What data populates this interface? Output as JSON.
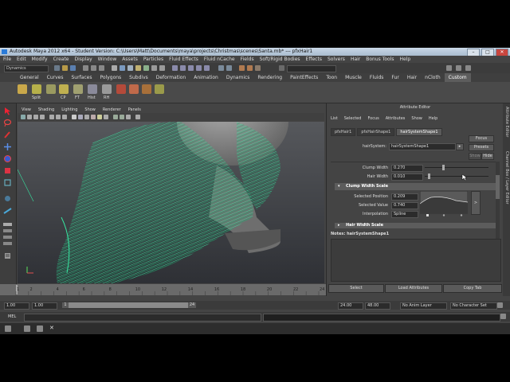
{
  "window": {
    "title": "Autodesk Maya 2012 x64 - Student Version: C:\\Users\\Matt\\Documents\\maya\\projects\\Christmas\\scenes\\Santa.mb* --- pfxHair1",
    "controls": {
      "minimize": "–",
      "maximize": "□",
      "close": "✕"
    }
  },
  "menubar": [
    "File",
    "Edit",
    "Modify",
    "Create",
    "Display",
    "Window",
    "Assets",
    "Particles",
    "Fluid Effects",
    "Fluid nCache",
    "Fields",
    "Soft/Rigid Bodies",
    "Effects",
    "Solvers",
    "Hair",
    "Bonus Tools",
    "Help"
  ],
  "statusline": {
    "menu_set": "Dynamics"
  },
  "shelf_tabs": {
    "items": [
      "General",
      "Curves",
      "Surfaces",
      "Polygons",
      "Subdivs",
      "Deformation",
      "Animation",
      "Dynamics",
      "Rendering",
      "PaintEffects",
      "Toon",
      "Muscle",
      "Fluids",
      "Fur",
      "Hair",
      "nCloth",
      "Custom"
    ],
    "active": "Custom"
  },
  "shelf_labels": [
    "Split",
    "CP",
    "FT",
    "Hist",
    "RH"
  ],
  "viewport": {
    "menu": [
      "View",
      "Shading",
      "Lighting",
      "Show",
      "Renderer",
      "Panels"
    ],
    "hair_color": "#37e5a0"
  },
  "attribute_editor": {
    "title": "Attribute Editor",
    "menu": [
      "List",
      "Selected",
      "Focus",
      "Attributes",
      "Show",
      "Help"
    ],
    "tabs": [
      "pfxHair1",
      "pfxHairShape1",
      "hairSystemShape1"
    ],
    "active_tab": "hairSystemShape1",
    "node_label": "hairSystem:",
    "node_value": "hairSystemShape1",
    "buttons": {
      "focus": "Focus",
      "presets": "Presets",
      "show": "Show",
      "hide": "Hide"
    },
    "attributes": [
      {
        "label": "Clump Width",
        "value": "0.270"
      },
      {
        "label": "Hair Width",
        "value": "0.010"
      }
    ],
    "section_clump": "Clump Width Scale",
    "selected_position_label": "Selected Position",
    "selected_position": "0.209",
    "selected_value_label": "Selected Value",
    "selected_value": "0.740",
    "interpolation_label": "Interpolation",
    "interpolation": "Spline",
    "section_next": "Hair Width Scale",
    "notes": "Notes:  hairSystemShape1",
    "bottom_buttons": [
      "Select",
      "Load Attributes",
      "Copy Tab"
    ]
  },
  "side_tabs": [
    "Attribute Editor",
    "Channel Box / Layer Editor"
  ],
  "timeline": {
    "ticks": [
      "1",
      "2",
      "4",
      "6",
      "8",
      "10",
      "12",
      "14",
      "16",
      "18",
      "20",
      "22",
      "24"
    ],
    "current_frame": "1.00"
  },
  "range": {
    "start": "1.00",
    "anim_start": "1.00",
    "range_start": "1",
    "range_end": "24",
    "anim_end": "24.00",
    "end": "48.00",
    "anim_layer": "No Anim Layer",
    "char_set": "No Character Set"
  },
  "cmdline": {
    "label": "MEL"
  }
}
